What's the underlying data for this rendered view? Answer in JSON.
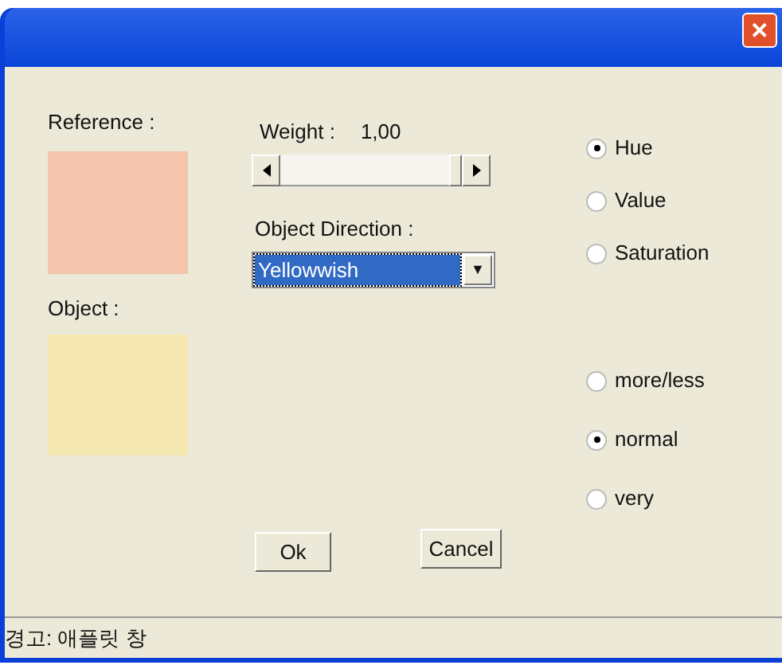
{
  "window": {
    "close_label": "✕"
  },
  "reference": {
    "label": "Reference :",
    "color": "#f4c4ac"
  },
  "object": {
    "label": "Object :",
    "color": "#f5e8b0"
  },
  "weight": {
    "label": "Weight :",
    "value": "1,00",
    "level": 1
  },
  "direction": {
    "label": "Object Direction :",
    "value": "Yellowwish",
    "arrow": "▼"
  },
  "component_options": [
    {
      "label": "Hue",
      "selected": true
    },
    {
      "label": "Value",
      "selected": false
    },
    {
      "label": "Saturation",
      "selected": false
    }
  ],
  "degree_options": [
    {
      "label": "more/less",
      "selected": false
    },
    {
      "label": "normal",
      "selected": true
    },
    {
      "label": "very",
      "selected": false
    }
  ],
  "buttons": [
    "Ok",
    "Cancel"
  ],
  "status_bar": "경고: 애플릿 창"
}
